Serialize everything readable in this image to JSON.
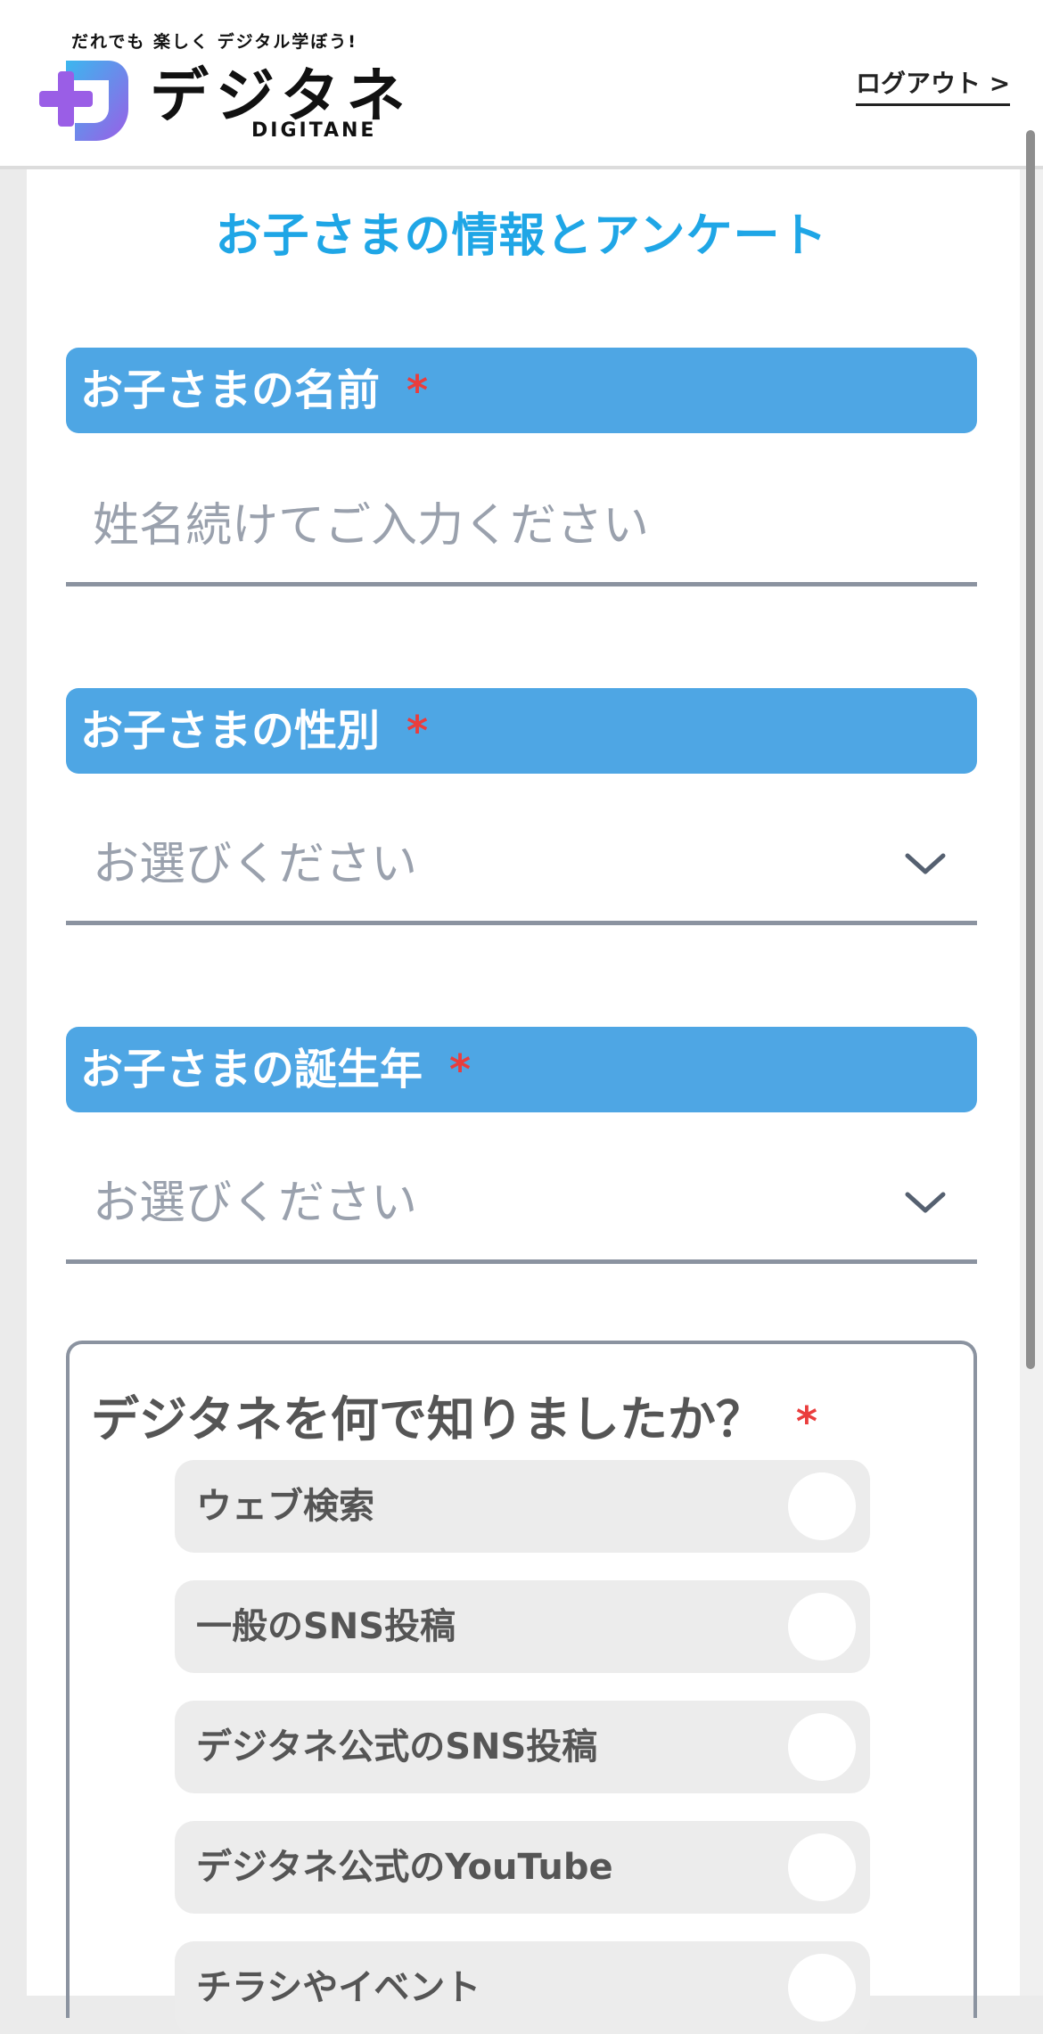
{
  "header": {
    "tagline": "だれでも 楽しく デジタル学ぼう!",
    "logo_title": "デジタネ",
    "logo_sub": "DIGITANE",
    "logout": "ログアウト >",
    "logo_colors": [
      "#3bb7ef",
      "#9a5ee6"
    ]
  },
  "page": {
    "title": "お子さまの情報とアンケート",
    "title_color": "#1fa6e6",
    "required_mark": "*"
  },
  "sections": {
    "name": {
      "label": "お子さまの名前",
      "placeholder": "姓名続けてご入力ください",
      "value": ""
    },
    "gender": {
      "label": "お子さまの性別",
      "selected": "お選びください",
      "icon": "chevron-down-icon"
    },
    "birth_year": {
      "label": "お子さまの誕生年",
      "selected": "お選びください",
      "icon": "chevron-down-icon"
    }
  },
  "survey": {
    "question": "デジタネを何で知りましたか？",
    "options": [
      {
        "label": "ウェブ検索",
        "checked": false
      },
      {
        "label": "一般のSNS投稿",
        "checked": false
      },
      {
        "label": "デジタネ公式のSNS投稿",
        "checked": false
      },
      {
        "label": "デジタネ公式のYouTube",
        "checked": false
      },
      {
        "label": "チラシやイベント",
        "checked": false
      }
    ]
  },
  "colors": {
    "section_bar": "#4ea6e4",
    "required": "#ea3d3d",
    "placeholder": "#9aa1ad"
  }
}
